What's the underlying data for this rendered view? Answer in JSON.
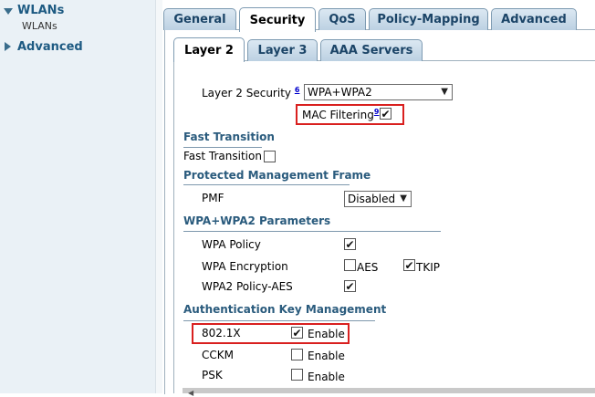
{
  "sidebar": {
    "wlans": "WLANs",
    "wlans_sub": "WLANs",
    "advanced": "Advanced"
  },
  "tabs": {
    "general": "General",
    "security": "Security",
    "qos": "QoS",
    "policy_mapping": "Policy-Mapping",
    "advanced": "Advanced"
  },
  "subtabs": {
    "layer2": "Layer 2",
    "layer3": "Layer 3",
    "aaa": "AAA Servers"
  },
  "layer2": {
    "security_label": "Layer 2 Security",
    "security_note": "6",
    "security_value": "WPA+WPA2",
    "mac_filtering_label": "MAC Filtering",
    "mac_filtering_note": "9",
    "mac_filtering_checked": true
  },
  "fast_transition": {
    "title": "Fast Transition",
    "label": "Fast Transition",
    "checked": false
  },
  "pmf": {
    "title": "Protected Management Frame",
    "label": "PMF",
    "value": "Disabled"
  },
  "wpa": {
    "title": "WPA+WPA2 Parameters",
    "policy_label": "WPA Policy",
    "policy_checked": true,
    "encryption_label": "WPA Encryption",
    "aes_label": "AES",
    "aes_checked": false,
    "tkip_label": "TKIP",
    "tkip_checked": true,
    "wpa2_label": "WPA2 Policy-AES",
    "wpa2_checked": true
  },
  "akm": {
    "title": "Authentication Key Management",
    "dot1x_label": "802.1X",
    "dot1x_checked": true,
    "cckm_label": "CCKM",
    "cckm_checked": false,
    "psk_label": "PSK",
    "psk_checked": false,
    "enable_label": "Enable"
  },
  "colors": {
    "highlight_border": "#d9201f",
    "section_title": "#2a5b7d",
    "nav_text": "#1d5a82"
  }
}
